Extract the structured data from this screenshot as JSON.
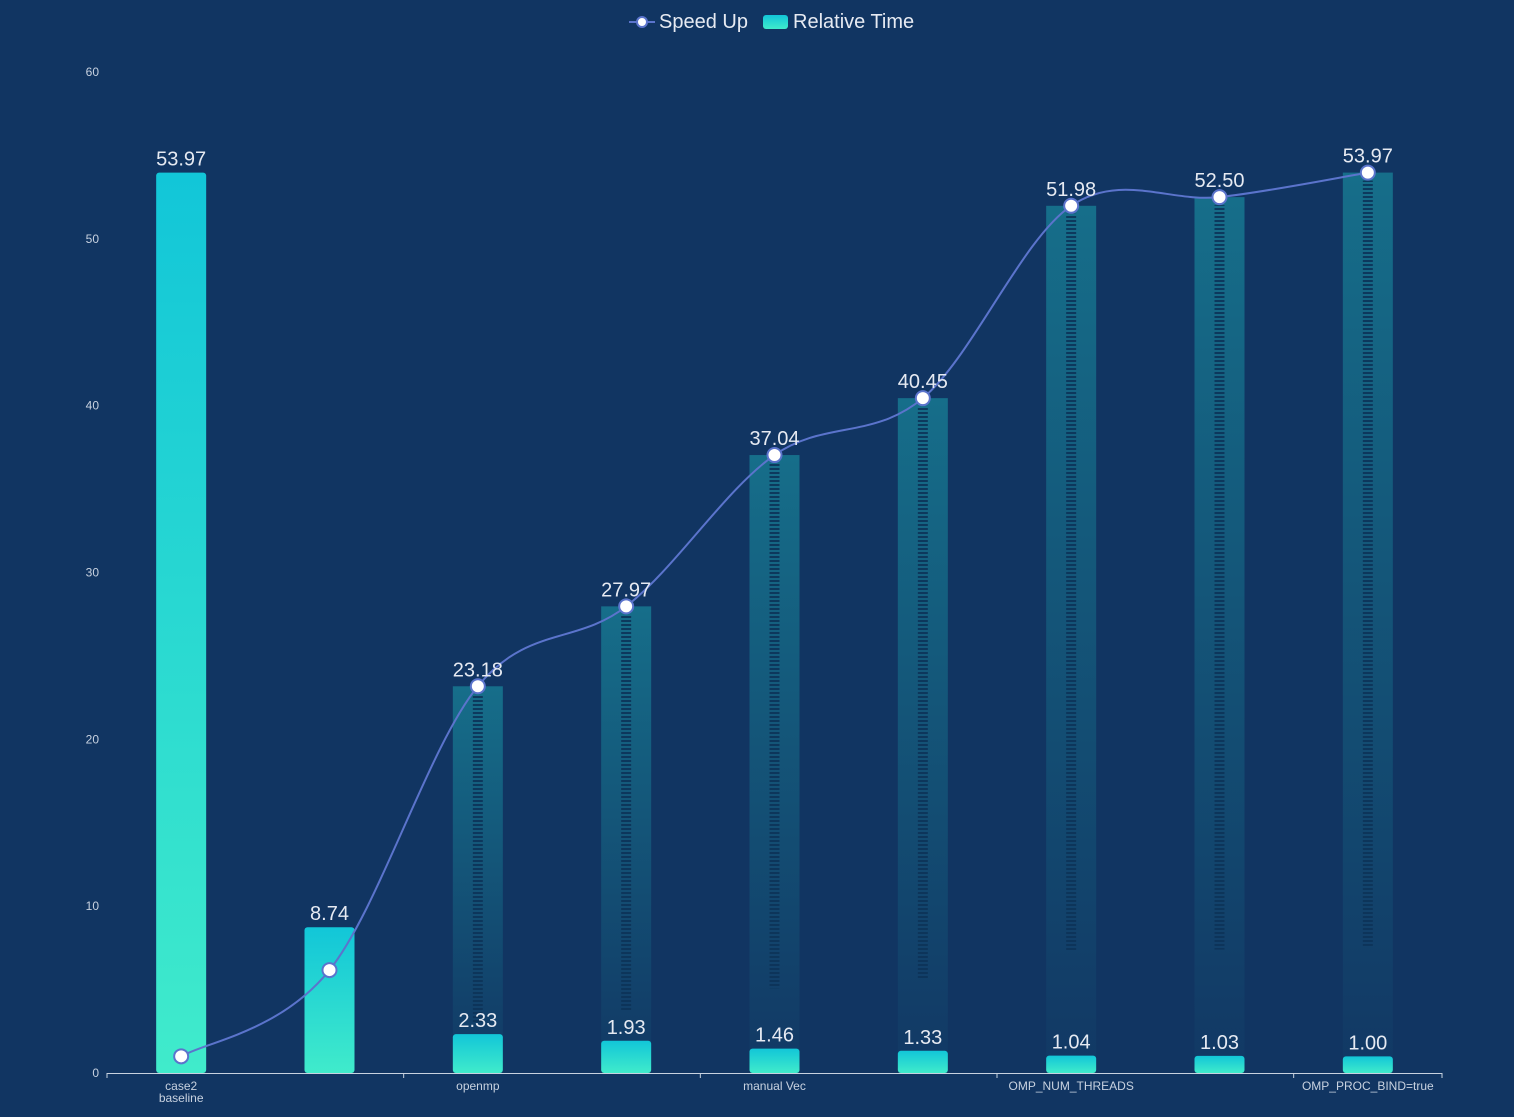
{
  "legend": {
    "speedup_label": "Speed Up",
    "time_label": "Relative Time"
  },
  "chart_data": {
    "type": "bar",
    "categories": [
      "case2\nbaseline",
      "",
      "openmp",
      "",
      "manual Vec",
      "",
      "OMP_NUM_THREADS",
      "",
      "OMP_PROC_BIND=true"
    ],
    "series": [
      {
        "name": "Relative Time",
        "type": "bar",
        "values": [
          53.97,
          8.74,
          2.33,
          1.93,
          1.46,
          1.33,
          1.04,
          1.03,
          1.0
        ]
      },
      {
        "name": "Speed Up",
        "type": "line",
        "values": [
          1.0,
          6.17,
          23.18,
          27.97,
          37.04,
          40.45,
          51.98,
          52.5,
          53.97
        ],
        "labels_shown": [
          false,
          false,
          true,
          true,
          true,
          true,
          true,
          true,
          true
        ]
      }
    ],
    "ylim": [
      0,
      60
    ],
    "yticks": [
      0,
      10,
      20,
      30,
      40,
      50,
      60
    ],
    "xticks_shown_at": [
      0,
      2,
      4,
      6,
      8
    ],
    "grid": false,
    "legend_position": "top-center",
    "colors": {
      "background": "#113562",
      "bar_top": "#12c6d8",
      "bar_bottom": "#40ebcb",
      "line": "#5b74cc",
      "marker_fill": "#ffffff",
      "label": "#e6eaf2",
      "axis": "#c8d2e0",
      "ghost_bar": "#16718c"
    }
  }
}
